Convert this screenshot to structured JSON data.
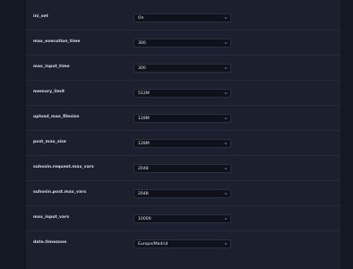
{
  "settings": [
    {
      "name": "ini_set",
      "value": "On"
    },
    {
      "name": "max_execution_time",
      "value": "300"
    },
    {
      "name": "max_input_time",
      "value": "300"
    },
    {
      "name": "memory_limit",
      "value": "512M"
    },
    {
      "name": "upload_max_filesize",
      "value": "128M"
    },
    {
      "name": "post_max_size",
      "value": "128M"
    },
    {
      "name": "suhosin.request.max_vars",
      "value": "2048"
    },
    {
      "name": "suhosin.post.max_vars",
      "value": "2048"
    },
    {
      "name": "max_input_vars",
      "value": "10000"
    },
    {
      "name": "date.timezone",
      "value": "Europe/Madrid"
    }
  ],
  "colors": {
    "background": "#141824",
    "panel": "#1b1f2e",
    "select_bg": "#0f121b",
    "text": "#d7dbe6"
  },
  "icons": {
    "select_chevron": "chevron-down-icon"
  }
}
